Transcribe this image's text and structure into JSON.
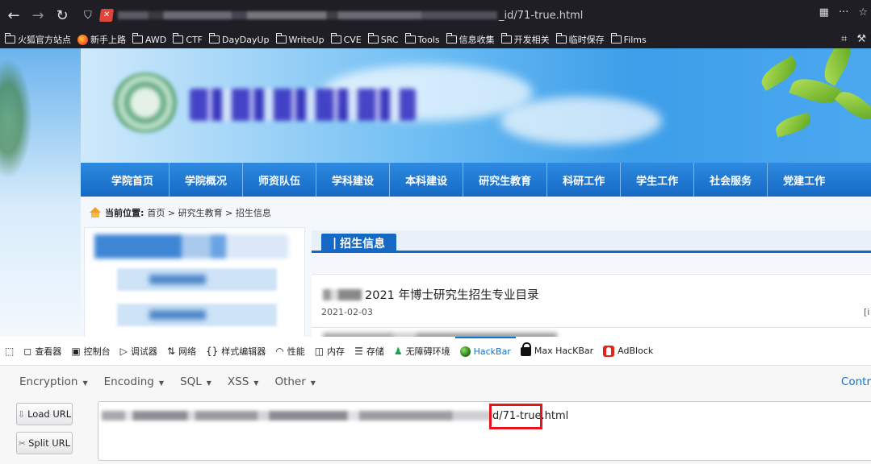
{
  "browser": {
    "url_visible_suffix": "_id/71-true.html",
    "bookmarks": [
      "火狐官方站点",
      "新手上路",
      "AWD",
      "CTF",
      "DayDayUp",
      "WriteUp",
      "CVE",
      "SRC",
      "Tools",
      "信息收集",
      "开发相关",
      "临时保存",
      "Films"
    ]
  },
  "site": {
    "nav": [
      "学院首页",
      "学院概况",
      "师资队伍",
      "学科建设",
      "本科建设",
      "研究生教育",
      "科研工作",
      "学生工作",
      "社会服务",
      "党建工作"
    ],
    "breadcrumb": {
      "label": "当前位置:",
      "path": "首页 > 研究生教育 > 招生信息"
    },
    "section_tab": "招生信息",
    "articles": [
      {
        "title": "2021 年博士研究生招生专业目录",
        "date": "2021-02-03",
        "more": "[i"
      }
    ]
  },
  "devtools": {
    "tabs": [
      {
        "icon": "inspector-icon",
        "label": "查看器"
      },
      {
        "icon": "console-icon",
        "label": "控制台"
      },
      {
        "icon": "debugger-icon",
        "label": "调试器"
      },
      {
        "icon": "network-icon",
        "label": "网络"
      },
      {
        "icon": "style-editor-icon",
        "label": "样式编辑器"
      },
      {
        "icon": "performance-icon",
        "label": "性能"
      },
      {
        "icon": "memory-icon",
        "label": "内存"
      },
      {
        "icon": "storage-icon",
        "label": "存储"
      },
      {
        "icon": "accessibility-icon",
        "label": "无障碍环境"
      },
      {
        "icon": "hackbar-icon",
        "label": "HackBar"
      },
      {
        "icon": "max-hackbar-icon",
        "label": "Max HacKBar"
      },
      {
        "icon": "adblock-icon",
        "label": "AdBlock"
      }
    ],
    "active_tab": "HackBar"
  },
  "hackbar": {
    "menus": [
      "Encryption",
      "Encoding",
      "SQL",
      "XSS",
      "Other"
    ],
    "contrib": "Contr",
    "buttons": {
      "load": "Load URL",
      "split": "Split URL"
    },
    "url_visible": "d/71-true.html"
  },
  "colors": {
    "nav_blue": "#1569c4",
    "highlight_red": "#e8141b",
    "hackbar_active": "#0a74da"
  }
}
